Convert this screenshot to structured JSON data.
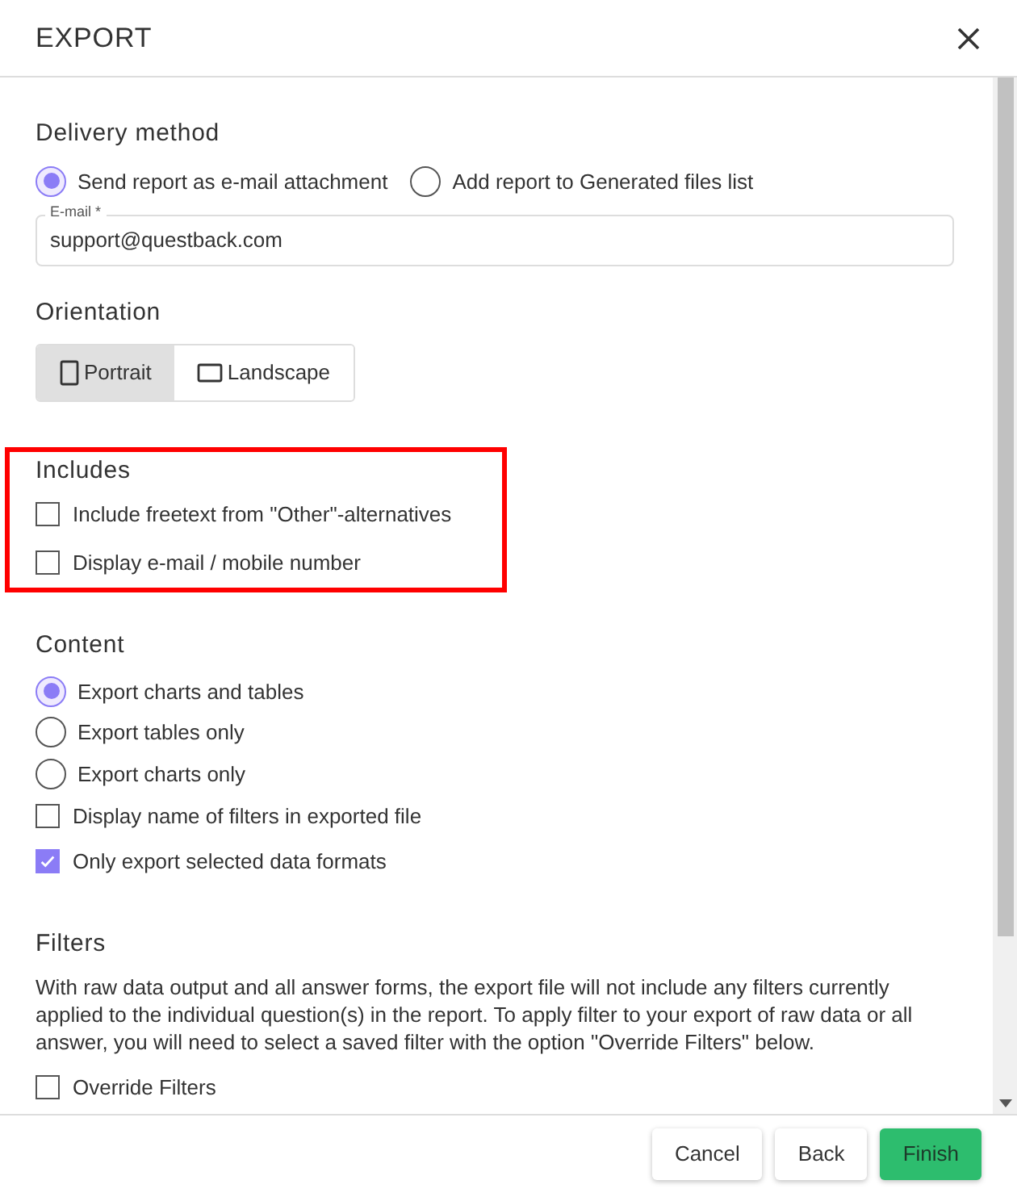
{
  "dialog": {
    "title": "EXPORT"
  },
  "delivery": {
    "heading": "Delivery method",
    "options": [
      {
        "label": "Send report as e-mail attachment",
        "selected": true
      },
      {
        "label": "Add report to Generated files list",
        "selected": false
      }
    ],
    "email": {
      "label": "E-mail *",
      "value": "support@questback.com"
    }
  },
  "orientation": {
    "heading": "Orientation",
    "options": [
      {
        "label": "Portrait",
        "kind": "portrait",
        "selected": true
      },
      {
        "label": "Landscape",
        "kind": "landscape",
        "selected": false
      }
    ]
  },
  "includes": {
    "heading": "Includes",
    "highlighted": true,
    "options": [
      {
        "label": "Include freetext from \"Other\"-alternatives",
        "checked": false
      },
      {
        "label": "Display e-mail / mobile number",
        "checked": false
      }
    ]
  },
  "content": {
    "heading": "Content",
    "options": [
      {
        "kind": "radio",
        "label": "Export charts and tables",
        "selected": true
      },
      {
        "kind": "radio",
        "label": "Export tables only",
        "selected": false
      },
      {
        "kind": "radio",
        "label": "Export charts only",
        "selected": false
      },
      {
        "kind": "checkbox",
        "label": "Display name of filters in exported file",
        "checked": false
      },
      {
        "kind": "checkbox",
        "label": "Only export selected data formats",
        "checked": true
      }
    ]
  },
  "filters": {
    "heading": "Filters",
    "description": "With raw data output and all answer forms, the export file will not include any filters currently applied to the individual question(s) in the report. To apply filter to your export of raw data or all answer, you will need to select a saved filter with the option \"Override Filters\" below.",
    "options": [
      {
        "label": "Override Filters",
        "checked": false
      }
    ]
  },
  "buttons": [
    {
      "label": "Cancel",
      "kind": "secondary"
    },
    {
      "label": "Back",
      "kind": "secondary"
    },
    {
      "label": "Finish",
      "kind": "primary"
    }
  ]
}
